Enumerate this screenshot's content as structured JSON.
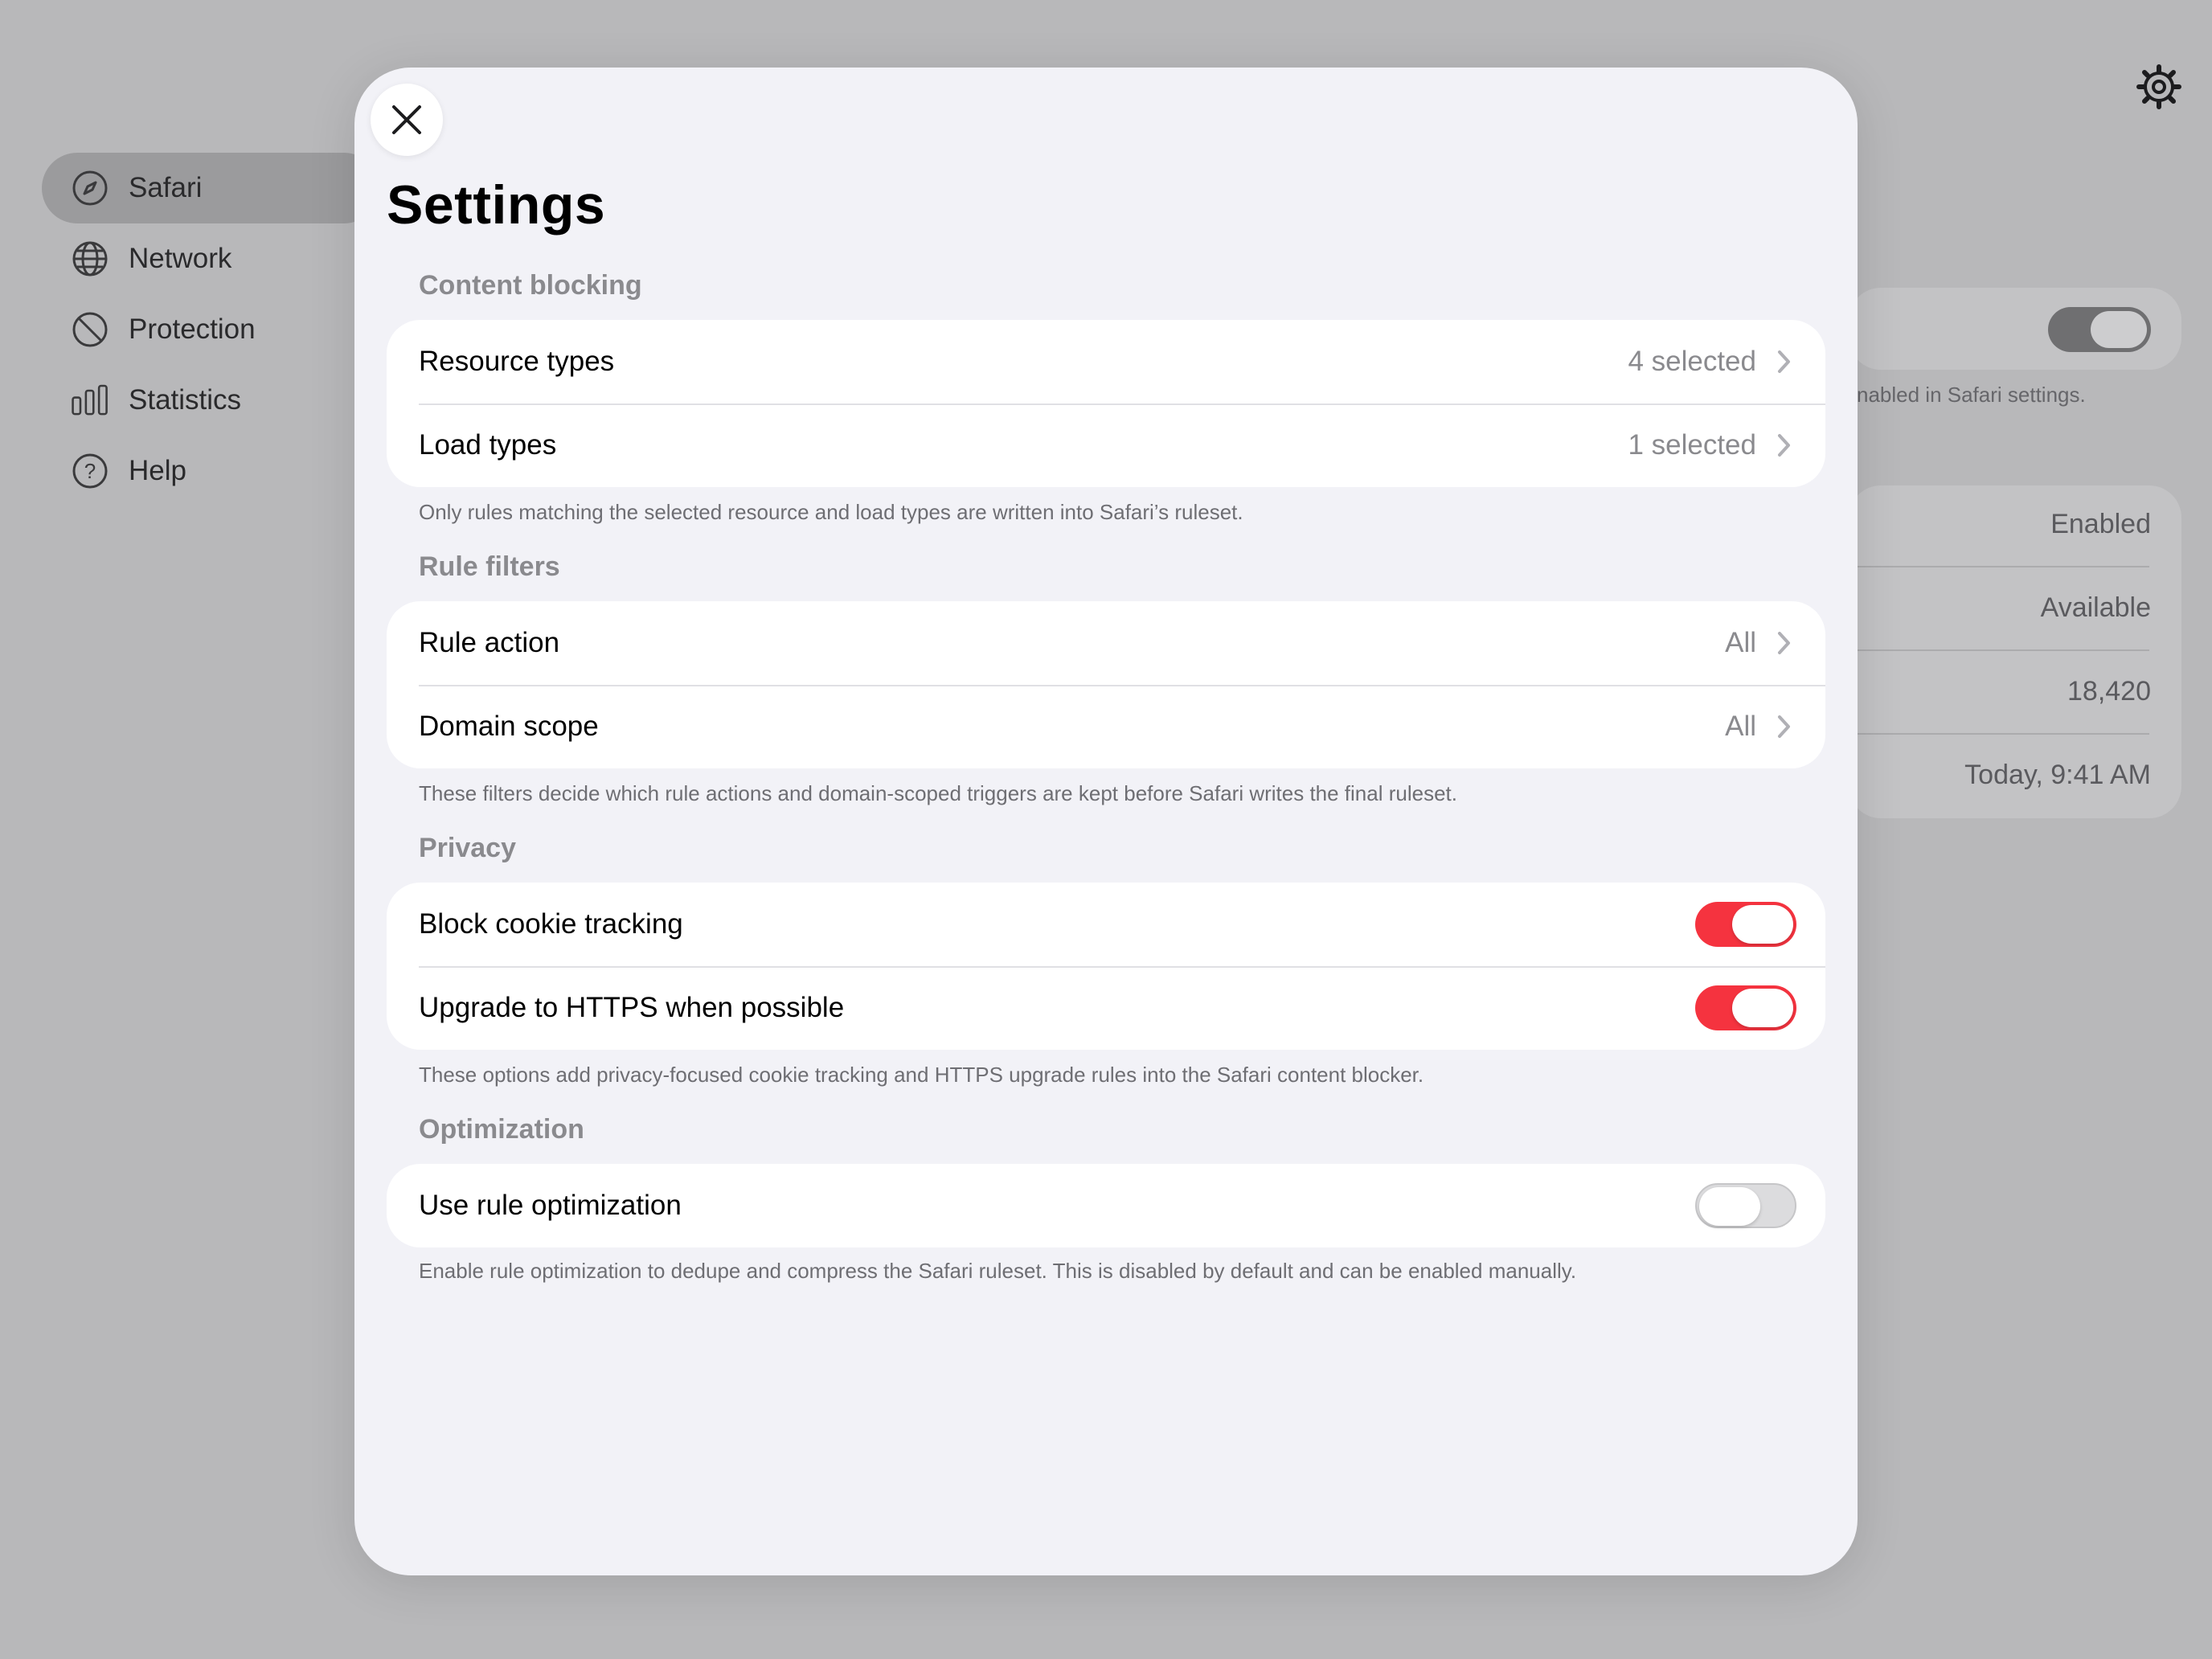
{
  "sidebar": {
    "items": [
      {
        "label": "Safari",
        "icon": "compass-icon",
        "selected": true
      },
      {
        "label": "Network",
        "icon": "globe-icon",
        "selected": false
      },
      {
        "label": "Protection",
        "icon": "prohibited-icon",
        "selected": false
      },
      {
        "label": "Statistics",
        "icon": "bar-chart-icon",
        "selected": false
      },
      {
        "label": "Help",
        "icon": "question-icon",
        "selected": false
      }
    ]
  },
  "background": {
    "note": "nabled in Safari settings.",
    "rows": [
      "Enabled",
      "Available",
      "18,420",
      "Today, 9:41 AM"
    ]
  },
  "modal": {
    "title": "Settings",
    "sections": [
      {
        "header": "Content blocking",
        "rows": [
          {
            "label": "Resource types",
            "value": "4 selected"
          },
          {
            "label": "Load types",
            "value": "1 selected"
          }
        ],
        "footer": "Only rules matching the selected resource and load types are written into Safari’s ruleset."
      },
      {
        "header": "Rule filters",
        "rows": [
          {
            "label": "Rule action",
            "value": "All"
          },
          {
            "label": "Domain scope",
            "value": "All"
          }
        ],
        "footer": "These filters decide which rule actions and domain-scoped triggers are kept before Safari writes the final ruleset."
      },
      {
        "header": "Privacy",
        "rows": [
          {
            "label": "Block cookie tracking",
            "toggle": true
          },
          {
            "label": "Upgrade to HTTPS when possible",
            "toggle": true
          }
        ],
        "footer": "These options add privacy-focused cookie tracking and HTTPS upgrade rules into the Safari content blocker."
      },
      {
        "header": "Optimization",
        "rows": [
          {
            "label": "Use rule optimization",
            "toggle": false
          }
        ],
        "footer": "Enable rule optimization to dedupe and compress the Safari ruleset. This is disabled by default and can be enabled manually."
      }
    ]
  },
  "colors": {
    "accent": "#f5333f",
    "background": "#f2f2f7"
  }
}
